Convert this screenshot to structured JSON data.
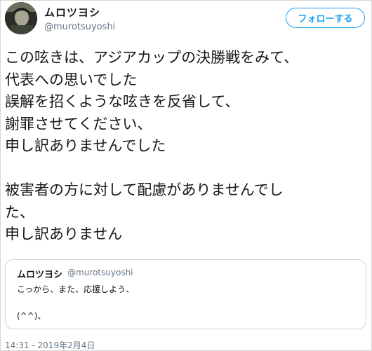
{
  "author": {
    "display_name": "ムロツヨシ",
    "handle": "@murotsuyoshi"
  },
  "follow_button": {
    "label": "フォローする"
  },
  "tweet": {
    "lines": [
      "この呟きは、アジアカップの決勝戦をみて、",
      "代表への思いでした",
      "誤解を招くような呟きを反省して、",
      "謝罪させてください、",
      "申し訳ありませんでした",
      "",
      "被害者の方に対して配慮がありませんでし",
      "た、",
      "申し訳ありません"
    ]
  },
  "quoted_tweet": {
    "display_name": "ムロツヨシ",
    "handle": "@murotsuyoshi",
    "line1": "こっから、また、応援しよう、",
    "line2": "(^^)、"
  },
  "timestamp": "14:31 - 2019年2月4日",
  "colors": {
    "accent": "#1da1f2",
    "text": "#14171a",
    "muted": "#657786",
    "border": "#ccd6dd"
  },
  "icons": {
    "avatar": "profile-photo"
  }
}
